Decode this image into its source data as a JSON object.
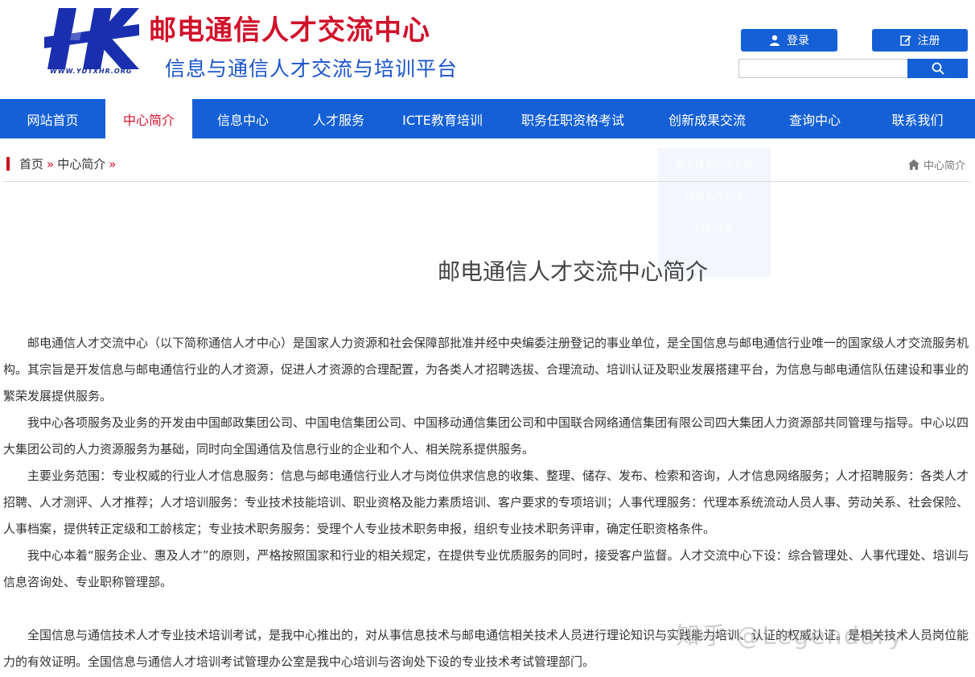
{
  "header": {
    "site_title": "邮电通信人才交流中心",
    "site_subtitle": "信息与通信人才交流与培训平台",
    "logo_url_text": "WWW.YDTXHR.ORG",
    "login_label": "登录",
    "register_label": "注册",
    "search_placeholder": ""
  },
  "nav": {
    "items": [
      "网站首页",
      "中心简介",
      "信息中心",
      "人才服务",
      "ICTE教育培训",
      "职务任职资格考试",
      "创新成果交流",
      "查询中心",
      "联系我们"
    ],
    "active_index": 1
  },
  "dropdown": {
    "items": [
      "职业技能培训大赛",
      "项目合作交流",
      "创新成果"
    ]
  },
  "breadcrumb": {
    "home": "首页",
    "current": "中心简介",
    "sep": "»",
    "right_label": "中心简介"
  },
  "article": {
    "title": "邮电通信人才交流中心简介",
    "paragraphs": [
      "邮电通信人才交流中心（以下简称通信人才中心）是国家人力资源和社会保障部批准并经中央编委注册登记的事业单位，是全国信息与邮电通信行业唯一的国家级人才交流服务机构。其宗旨是开发信息与邮电通信行业的人才资源，促进人才资源的合理配置，为各类人才招聘选拔、合理流动、培训认证及职业发展搭建平台，为信息与邮电通信队伍建设和事业的繁荣发展提供服务。",
      "我中心各项服务及业务的开发由中国邮政集团公司、中国电信集团公司、中国移动通信集团公司和中国联合网络通信集团有限公司四大集团人力资源部共同管理与指导。中心以四大集团公司的人力资源服务为基础，同时向全国通信及信息行业的企业和个人、相关院系提供服务。",
      "主要业务范围：专业权威的行业人才信息服务：信息与邮电通信行业人才与岗位供求信息的收集、整理、储存、发布、检索和咨询，人才信息网络服务；人才招聘服务：各类人才招聘、人才测评、人才推荐；人才培训服务：专业技术技能培训、职业资格及能力素质培训、客户要求的专项培训；人事代理服务：代理本系统流动人员人事、劳动关系、社会保险、人事档案，提供转正定级和工龄核定；专业技术职务服务：受理个人专业技术职务申报，组织专业技术职务评审，确定任职资格条件。",
      "我中心本着“服务企业、惠及人才”的原则，严格按照国家和行业的相关规定，在提供专业优质服务的同时，接受客户监督。人才交流中心下设：综合管理处、人事代理处、培训与信息咨询处、专业职称管理部。",
      "全国信息与通信技术人才专业技术培训考试，是我中心推出的，对从事信息技术与邮电通信相关技术人员进行理论知识与实践能力培训、认证的权威认证。是相关技术人员岗位能力的有效证明。全国信息与通信人才培训考试管理办公室是我中心培训与咨询处下设的专业技术考试管理部门。"
    ]
  },
  "watermark": "知乎 @Legendary"
}
